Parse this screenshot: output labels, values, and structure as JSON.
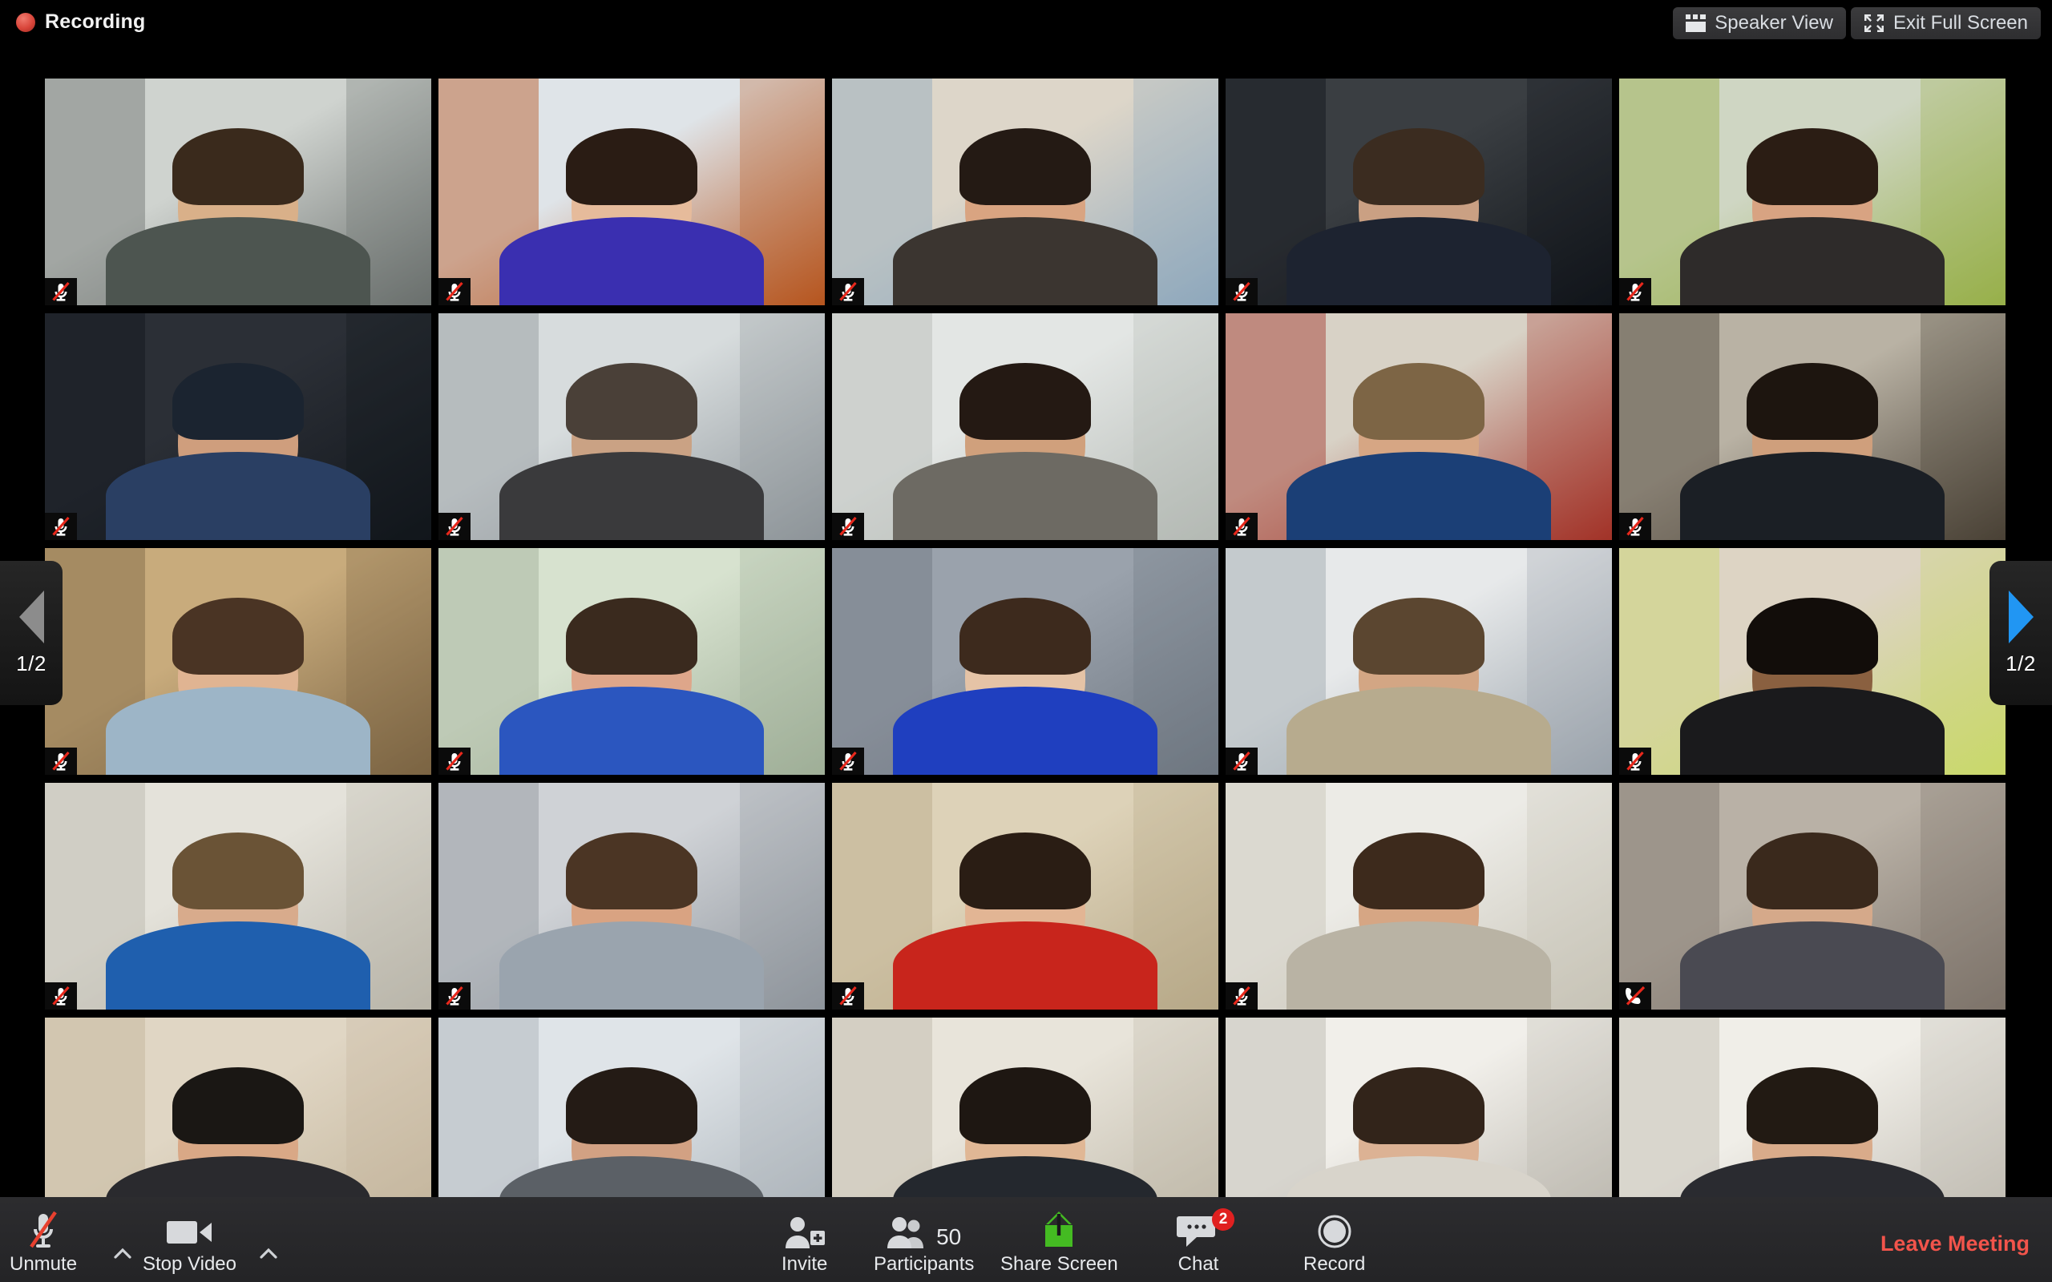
{
  "header": {
    "recording_label": "Recording",
    "recording_dot_color": "#d9453a",
    "buttons": [
      {
        "label": "Speaker View",
        "icon": "grid-layout-icon"
      },
      {
        "label": "Exit Full Screen",
        "icon": "exit-fullscreen-icon"
      }
    ]
  },
  "navigation": {
    "prev": {
      "icon": "chevron-left-icon",
      "page_label": "1/2",
      "enabled": false,
      "color": "#8c8c8c"
    },
    "next": {
      "icon": "chevron-right-icon",
      "page_label": "1/2",
      "enabled": true,
      "color": "#2196f3"
    }
  },
  "gallery": {
    "columns": 5,
    "rows": 5,
    "mute_icon": "mic-muted-icon",
    "phone_muted_icon": "phone-muted-icon",
    "participants": [
      {
        "row": 1,
        "col": 1,
        "status_icon": "mic-muted-icon",
        "scene": "office-desks",
        "skin": "#d9b089",
        "hair": "#3a2a1c",
        "top": "#4d5550",
        "bg1": "#cfd3cf",
        "bg2": "#6a6f6d"
      },
      {
        "row": 1,
        "col": 2,
        "status_icon": "mic-muted-icon",
        "scene": "window-bright",
        "skin": "#e6bb9b",
        "hair": "#2a1c14",
        "top": "#3a2fb0",
        "bg1": "#dfe4e8",
        "bg2": "#b6551f"
      },
      {
        "row": 1,
        "col": 3,
        "status_icon": "mic-muted-icon",
        "scene": "home-window",
        "skin": "#d9a481",
        "hair": "#241a14",
        "top": "#3b3530",
        "bg1": "#ddd6c9",
        "bg2": "#8fa8bd"
      },
      {
        "row": 1,
        "col": 4,
        "status_icon": "mic-muted-icon",
        "scene": "dark-office",
        "skin": "#caa083",
        "hair": "#3b2c20",
        "top": "#1d2330",
        "bg1": "#3a3e42",
        "bg2": "#11151a"
      },
      {
        "row": 1,
        "col": 5,
        "status_icon": "mic-muted-icon",
        "scene": "green-wall",
        "skin": "#d8a382",
        "hair": "#2b1d14",
        "top": "#2e2b2a",
        "bg1": "#cfd6c3",
        "bg2": "#97b04a"
      },
      {
        "row": 2,
        "col": 1,
        "status_icon": "mic-muted-icon",
        "scene": "dark-room-cap",
        "skin": "#cf9e7d",
        "hair": "#1b2430",
        "top": "#2a3f63",
        "bg1": "#2b2f36",
        "bg2": "#12161c"
      },
      {
        "row": 2,
        "col": 2,
        "status_icon": "mic-muted-icon",
        "scene": "glass-office",
        "skin": "#caa284",
        "hair": "#4a4038",
        "top": "#3a3a3c",
        "bg1": "#d7dcdd",
        "bg2": "#8d9499"
      },
      {
        "row": 2,
        "col": 3,
        "status_icon": "mic-muted-icon",
        "scene": "bright-windows",
        "skin": "#d0a07c",
        "hair": "#241913",
        "top": "#6d6a63",
        "bg1": "#e3e6e4",
        "bg2": "#b4b9b4"
      },
      {
        "row": 2,
        "col": 4,
        "status_icon": "mic-muted-icon",
        "scene": "red-poster",
        "skin": "#d6a684",
        "hair": "#7d6545",
        "top": "#1b3f76",
        "bg1": "#d8d2c6",
        "bg2": "#a23328"
      },
      {
        "row": 2,
        "col": 5,
        "status_icon": "mic-muted-icon",
        "scene": "bookshelf",
        "skin": "#cf9f7c",
        "hair": "#1d150f",
        "top": "#1b1f25",
        "bg1": "#b9b2a4",
        "bg2": "#4a4136"
      },
      {
        "row": 3,
        "col": 1,
        "status_icon": "mic-muted-icon",
        "scene": "boxes-storage",
        "skin": "#e0b492",
        "hair": "#4a3424",
        "top": "#9db5c7",
        "bg1": "#c8ab7c",
        "bg2": "#7b6443"
      },
      {
        "row": 3,
        "col": 2,
        "status_icon": "mic-muted-icon",
        "scene": "pale-green-wall",
        "skin": "#dea68a",
        "hair": "#3a2a1e",
        "top": "#2b56bf",
        "bg1": "#d7e2cf",
        "bg2": "#9fae97"
      },
      {
        "row": 3,
        "col": 3,
        "status_icon": "mic-muted-icon",
        "scene": "gray-wall",
        "skin": "#e5c3a6",
        "hair": "#3d2a1d",
        "top": "#1f3fbf",
        "bg1": "#9aa2ac",
        "bg2": "#6e7680"
      },
      {
        "row": 3,
        "col": 4,
        "status_icon": "mic-muted-icon",
        "scene": "open-office",
        "skin": "#d3a684",
        "hair": "#5b4630",
        "top": "#b7ab8e",
        "bg1": "#e7e9ea",
        "bg2": "#9aa3ab"
      },
      {
        "row": 3,
        "col": 5,
        "status_icon": "mic-muted-icon",
        "scene": "headphones-yellow",
        "skin": "#8a6040",
        "hair": "#120d0a",
        "top": "#1a1a1c",
        "bg1": "#ddd4c4",
        "bg2": "#c9d86a"
      },
      {
        "row": 4,
        "col": 1,
        "status_icon": "mic-muted-icon",
        "scene": "white-door",
        "skin": "#d8ab8c",
        "hair": "#6a5336",
        "top": "#1f5fae",
        "bg1": "#e4e2da",
        "bg2": "#b9b5aa"
      },
      {
        "row": 4,
        "col": 2,
        "status_icon": "mic-muted-icon",
        "scene": "striped-wall",
        "skin": "#d9a382",
        "hair": "#4b3524",
        "top": "#9aa4ae",
        "bg1": "#cfd2d6",
        "bg2": "#8e949b"
      },
      {
        "row": 4,
        "col": 3,
        "status_icon": "mic-muted-icon",
        "scene": "beige-wall",
        "skin": "#e2b594",
        "hair": "#2a1d14",
        "top": "#c8251c",
        "bg1": "#ddd2b8",
        "bg2": "#b7a888"
      },
      {
        "row": 4,
        "col": 4,
        "status_icon": "mic-muted-icon",
        "scene": "whiteboard",
        "skin": "#d6a684",
        "hair": "#3d2a1c",
        "top": "#b9b3a4",
        "bg1": "#ecebe6",
        "bg2": "#c7c3b6"
      },
      {
        "row": 4,
        "col": 5,
        "status_icon": "phone-muted-icon",
        "scene": "couch-room",
        "skin": "#d5a98a",
        "hair": "#3a291c",
        "top": "#4a4a52",
        "bg1": "#b9b1a6",
        "bg2": "#7d736a"
      },
      {
        "row": 5,
        "col": 1,
        "status_icon": "mic-muted-icon",
        "scene": "curtains",
        "skin": "#d9a886",
        "hair": "#1a1714",
        "top": "#2a2a2e",
        "bg1": "#e0d6c4",
        "bg2": "#c2b49a"
      },
      {
        "row": 5,
        "col": 2,
        "status_icon": "mic-muted-icon",
        "scene": "winter-window",
        "skin": "#d2a183",
        "hair": "#241b15",
        "top": "#5b6066",
        "bg1": "#dfe4e8",
        "bg2": "#a8b0b6"
      },
      {
        "row": 5,
        "col": 3,
        "status_icon": "mic-muted-icon",
        "scene": "shelves",
        "skin": "#e0b795",
        "hair": "#1e1712",
        "top": "#24282e",
        "bg1": "#e8e4da",
        "bg2": "#bdb6a6"
      },
      {
        "row": 5,
        "col": 4,
        "status_icon": "mic-muted-icon",
        "scene": "white-hallway",
        "skin": "#dcb294",
        "hair": "#32241a",
        "top": "#d8d4cb",
        "bg1": "#f1efea",
        "bg2": "#b9b5ac"
      },
      {
        "row": 5,
        "col": 5,
        "status_icon": "mic-muted-icon",
        "scene": "white-hallway-2",
        "skin": "#d9ab8a",
        "hair": "#221a13",
        "top": "#2a2b30",
        "bg1": "#f0eee8",
        "bg2": "#bdb8ae"
      }
    ]
  },
  "toolbar": {
    "audio": {
      "label": "Unmute",
      "icon": "mic-muted-icon",
      "caret": "chevron-up-icon"
    },
    "video": {
      "label": "Stop Video",
      "icon": "camera-icon",
      "caret": "chevron-up-icon"
    },
    "invite": {
      "label": "Invite",
      "icon": "person-add-icon"
    },
    "participants": {
      "label": "Participants",
      "icon": "people-icon",
      "count": "50"
    },
    "share": {
      "label": "Share Screen",
      "icon": "share-screen-icon",
      "color": "#44bb22"
    },
    "chat": {
      "label": "Chat",
      "icon": "chat-bubble-icon",
      "badge": "2",
      "badge_color": "#e02020"
    },
    "record": {
      "label": "Record",
      "icon": "record-circle-icon"
    },
    "leave": {
      "label": "Leave Meeting",
      "color": "#f2544b"
    }
  }
}
